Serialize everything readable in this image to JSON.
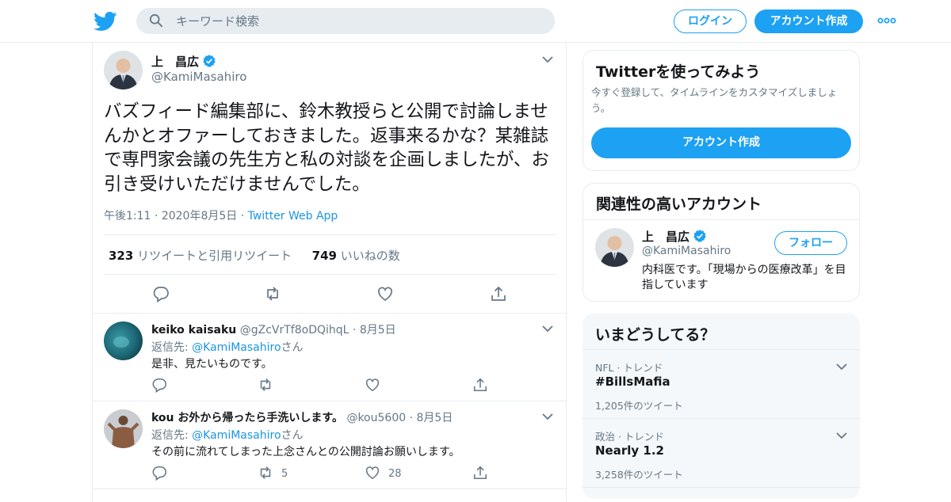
{
  "header": {
    "search_placeholder": "キーワード検索",
    "login_label": "ログイン",
    "signup_label": "アカウント作成"
  },
  "tweet": {
    "name": "上　昌広",
    "handle": "@KamiMasahiro",
    "text": "バズフィード編集部に、鈴木教授らと公開で討論しませんかとオファーしておきました。返事来るかな？某雑誌で専門家会議の先生方と私の対談を企画しましたが、お引き受けいただけませんでした。",
    "time": "午後1:11",
    "date": "2020年8月5日",
    "source": "Twitter Web App",
    "retweets_count": "323",
    "retweets_label": "リツイートと引用リツイート",
    "likes_count": "749",
    "likes_label": "いいねの数"
  },
  "replies": [
    {
      "name": "keiko kaisaku",
      "handle": "@gZcVrTf8oDQihqL",
      "date": "8月5日",
      "reply_to_label": "返信先: ",
      "mention": "@KamiMasahiro",
      "san": "さん",
      "text": "是非、見たいものです。",
      "retweets": "",
      "likes": ""
    },
    {
      "name": "kou お外から帰ったら手洗いします。",
      "handle": "@kou5600",
      "date": "8月5日",
      "reply_to_label": "返信先: ",
      "mention": "@KamiMasahiro",
      "san": "さん",
      "text": "その前に流れてしまった上念さんとの公開討論お願いします。",
      "retweets": "5",
      "likes": "28"
    }
  ],
  "signup_card": {
    "title": "Twitterを使ってみよう",
    "subtitle": "今すぐ登録して、タイムラインをカスタマイズしましょう。",
    "button": "アカウント作成"
  },
  "related": {
    "title": "関連性の高いアカウント",
    "name": "上　昌広",
    "handle": "@KamiMasahiro",
    "bio": "内科医です。「現場からの医療改革」を目指しています",
    "follow_label": "フォロー"
  },
  "trends": {
    "title": "いまどうしてる？",
    "items": [
      {
        "context": "NFL · トレンド",
        "name": "#BillsMafia",
        "count": "1,205件のツイート"
      },
      {
        "context": "政治 · トレンド",
        "name": "Nearly 1.2",
        "count": "3,258件のツイート"
      }
    ]
  },
  "colors": {
    "brand": "#1da1f2",
    "text": "#14171a",
    "muted": "#657786",
    "border": "#e6ecf0"
  }
}
